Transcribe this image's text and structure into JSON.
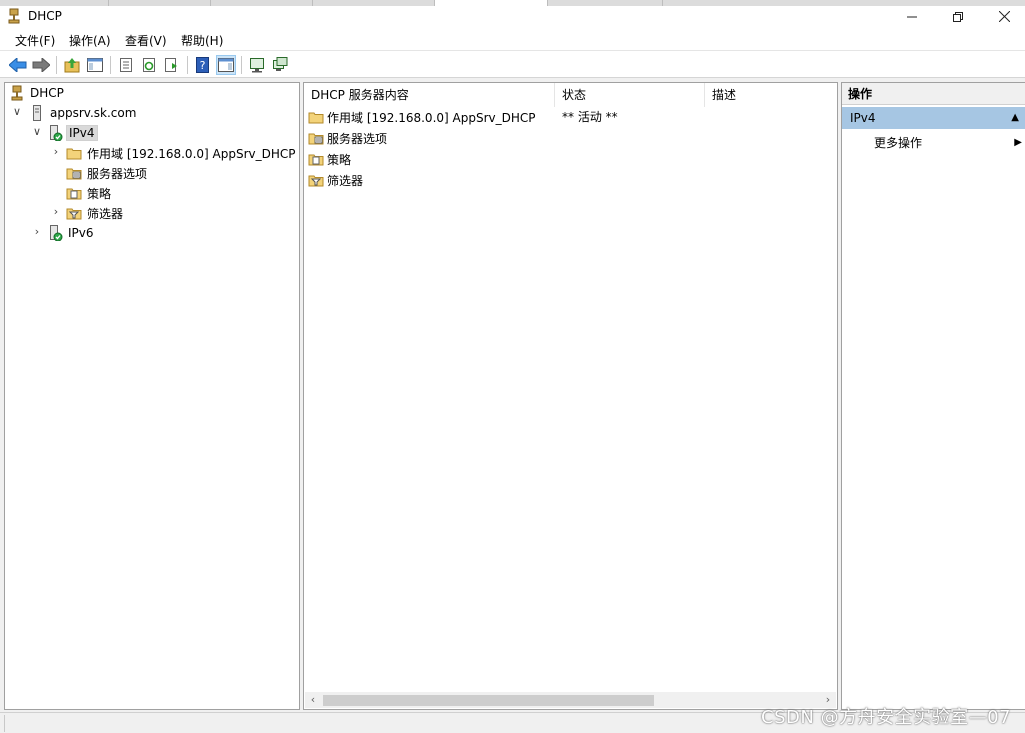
{
  "window": {
    "title": "DHCP"
  },
  "menu": [
    "文件(F)",
    "操作(A)",
    "查看(V)",
    "帮助(H)"
  ],
  "tree": {
    "root": "DHCP",
    "server": "appsrv.sk.com",
    "ipv4": "IPv4",
    "scope": "作用域 [192.168.0.0] AppSrv_DHCP",
    "server_options": "服务器选项",
    "policies": "策略",
    "filters": "筛选器",
    "ipv6": "IPv6"
  },
  "content": {
    "columns": [
      "DHCP 服务器内容",
      "状态",
      "描述"
    ],
    "rows": [
      {
        "name": "作用域 [192.168.0.0] AppSrv_DHCP",
        "status": "** 活动 **",
        "icon": "folder-icon"
      },
      {
        "name": "服务器选项",
        "status": "",
        "icon": "server-options-icon"
      },
      {
        "name": "策略",
        "status": "",
        "icon": "policy-icon"
      },
      {
        "name": "筛选器",
        "status": "",
        "icon": "filter-icon"
      }
    ]
  },
  "actions": {
    "header": "操作",
    "section": "IPv4",
    "item": "更多操作"
  },
  "watermark": "CSDN @方舟安全实验室—07"
}
